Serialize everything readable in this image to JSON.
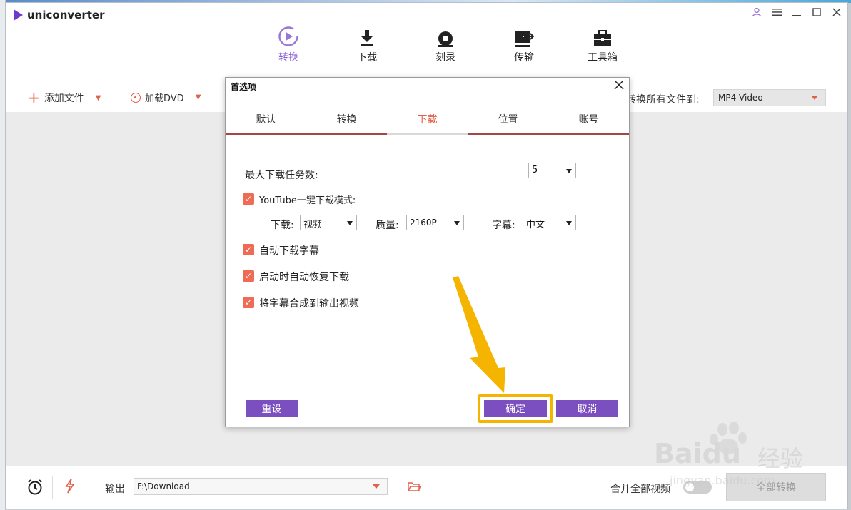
{
  "app": {
    "title": "uniconverter",
    "window_controls": [
      "user-icon",
      "menu-icon",
      "minimize-icon",
      "maximize-icon",
      "close-icon"
    ]
  },
  "main_tabs": [
    {
      "label": "转换",
      "icon": "convert-icon",
      "active": true
    },
    {
      "label": "下载",
      "icon": "download-icon",
      "active": false
    },
    {
      "label": "刻录",
      "icon": "burn-icon",
      "active": false
    },
    {
      "label": "传输",
      "icon": "transfer-icon",
      "active": false
    },
    {
      "label": "工具箱",
      "icon": "toolbox-icon",
      "active": false
    }
  ],
  "toolbar": {
    "add_files": "添加文件",
    "load_dvd": "加载DVD",
    "convert_all_to": "转换所有文件到:",
    "format_value": "MP4 Video"
  },
  "bottom": {
    "output_label": "输出",
    "output_path": "F:\\Download",
    "merge_label": "合并全部视频",
    "convert_all_button": "全部转换"
  },
  "dialog": {
    "title": "首选项",
    "tabs": [
      {
        "label": "默认",
        "active": false
      },
      {
        "label": "转换",
        "active": false
      },
      {
        "label": "下载",
        "active": true
      },
      {
        "label": "位置",
        "active": false
      },
      {
        "label": "账号",
        "active": false
      }
    ],
    "max_tasks_label": "最大下载任务数:",
    "max_tasks_value": "5",
    "youtube_mode_label": "YouTube一键下载模式:",
    "download_label": "下载:",
    "download_value": "视频",
    "quality_label": "质量:",
    "quality_value": "2160P",
    "subtitle_label": "字幕:",
    "subtitle_value": "中文",
    "auto_subtitle_label": "自动下载字幕",
    "resume_label": "启动时自动恢复下载",
    "merge_subtitle_label": "将字幕合成到输出视频",
    "checkboxes_checked": [
      true,
      true,
      true,
      true
    ],
    "reset_button": "重设",
    "ok_button": "确定",
    "cancel_button": "取消"
  },
  "watermark": {
    "brand": "Baidu",
    "cn": "经验",
    "url": "jingyan.baidu.com"
  },
  "colors": {
    "accent_purple": "#7b4fc0",
    "accent_orange": "#e0604a",
    "highlight": "#f5b400",
    "checkbox": "#ef6b55"
  }
}
